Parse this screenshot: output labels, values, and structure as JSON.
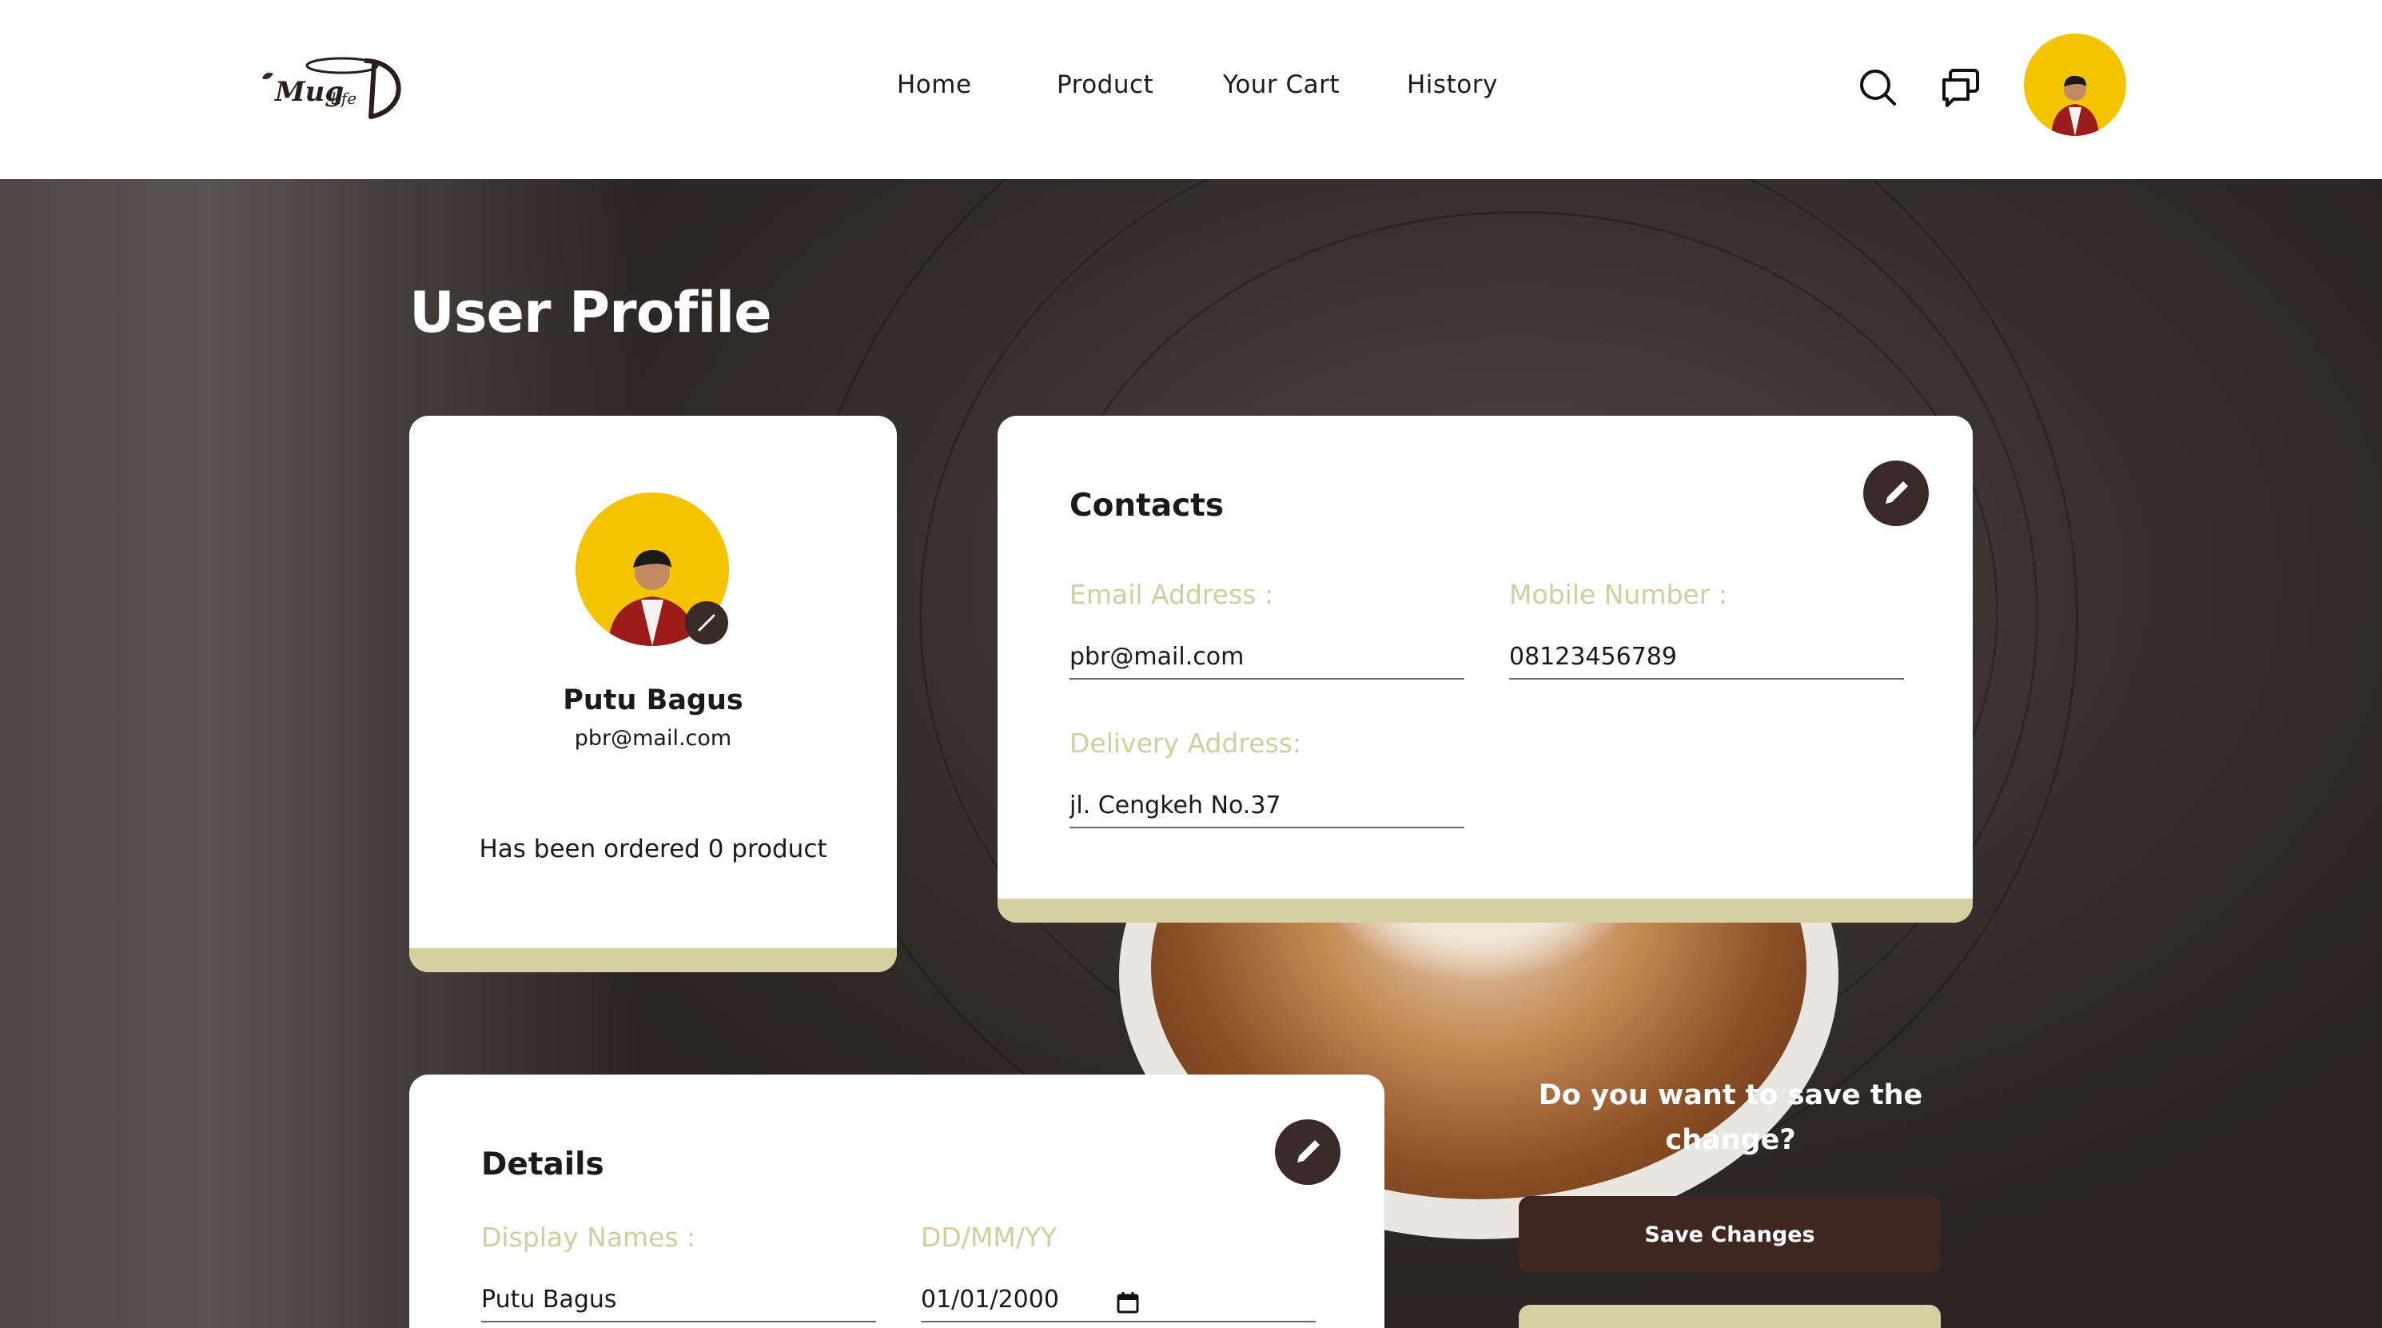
{
  "nav": {
    "logo_text": "Mug life",
    "links": [
      "Home",
      "Product",
      "Your Cart",
      "History"
    ]
  },
  "page": {
    "title": "User Profile"
  },
  "profile": {
    "name": "Putu Bagus",
    "email": "pbr@mail.com",
    "orders_text": "Has been ordered 0 product"
  },
  "contacts": {
    "title": "Contacts",
    "email_label": "Email Address :",
    "email_value": "pbr@mail.com",
    "mobile_label": "Mobile Number :",
    "mobile_value": "08123456789",
    "address_label": "Delivery Address:",
    "address_value": "jl. Cengkeh No.37"
  },
  "details": {
    "title": "Details",
    "display_name_label": "Display Names :",
    "display_name_value": "Putu Bagus",
    "date_label": "DD/MM/YY",
    "date_value": "01/01/2000"
  },
  "save": {
    "question": "Do you want to save the change?",
    "button_label": "Save Changes"
  },
  "colors": {
    "accent": "#d6cf9f",
    "dark_brown": "#3e2621",
    "avatar_bg": "#f5c400"
  }
}
